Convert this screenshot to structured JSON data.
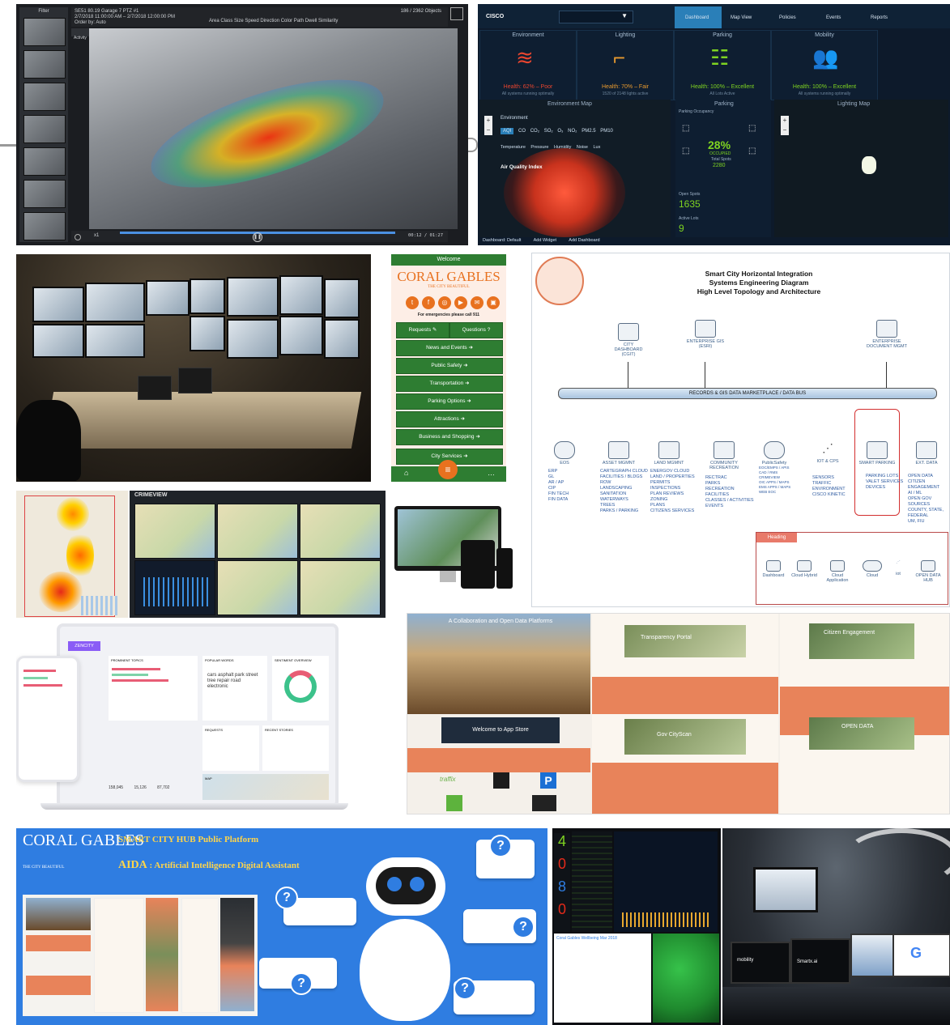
{
  "video": {
    "title": "SE51 80.19 Garage 7 PTZ #1",
    "date_range": "2/7/2018 11:00:00 AM – 2/7/2018 12:00:00 PM",
    "filter": "Order by: Auto",
    "objects": "186 / 2362 Objects",
    "activity_label": "Activity",
    "filters": "Area  Class  Size  Speed  Direction  Color  Path  Dwell  Similarity",
    "speed": "x1",
    "time": "00:12 / 01:27",
    "thumbs_label": "Filter"
  },
  "dash": {
    "brand": "CISCO",
    "tabs": [
      "Dashboard",
      "Map View",
      "Policies",
      "Events",
      "Reports"
    ],
    "cards": [
      {
        "title": "Environment",
        "health": "Health: 62% – Poor",
        "sub": "All systems running optimally",
        "color": "#e8452f"
      },
      {
        "title": "Lighting",
        "health": "Health: 70% – Fair",
        "sub": "1520 of 2148 lights active",
        "color": "#e89a2f"
      },
      {
        "title": "Parking",
        "health": "Health: 100% – Excellent",
        "sub": "All Lots Active",
        "color": "#7ed321"
      },
      {
        "title": "Mobility",
        "health": "Health: 100% – Excellent",
        "sub": "All systems running optimally",
        "color": "#7ed321"
      }
    ],
    "env_map_title": "Environment Map",
    "parking_title": "Parking",
    "lighting_map_title": "Lighting Map",
    "env_select": "Environment",
    "pollutants": [
      "AQI",
      "CO",
      "CO₂",
      "SO₂",
      "O₃",
      "NO₂",
      "PM2.5",
      "PM10"
    ],
    "weather": [
      "Temperature",
      "Pressure",
      "Humidity",
      "Noise",
      "Lux"
    ],
    "aqi_label": "Air Quality Index",
    "occupancy_label": "Parking Occupancy",
    "occupied_pct": "28%",
    "occupied_label": "OCCUPIED",
    "total_spots_label": "Total Spots",
    "total_spots": "2280",
    "open_spots_label": "Open Spots",
    "open_spots": "1635",
    "active_lots_label": "Active Lots",
    "active_lots": "9",
    "footer": [
      "Dashboard: Default",
      "Add Widget",
      "Add Dashboard"
    ]
  },
  "app": {
    "welcome": "Welcome",
    "logo": "CORAL GABLES",
    "tagline": "THE CITY BEAUTIFUL",
    "emergency": "For emergencies please call 911",
    "requests": "Requests",
    "questions": "Questions",
    "menu": [
      "News and Events",
      "Public Safety",
      "Transportation",
      "Parking Options",
      "Attractions",
      "Business and Shopping",
      "City Services"
    ]
  },
  "diagram": {
    "title1": "Smart City Horizontal Integration",
    "title2": "Systems Engineering Diagram",
    "title3": "High Level Topology and Architecture",
    "bus": "RECORDS & GIS DATA MARKETPLACE / DATA BUS",
    "top_nodes": [
      "CITY DASHBOARD (CGIT)",
      "ENTERPRISE GIS (ESRI)",
      "ENTERPRISE DOCUMENT MGMT"
    ],
    "nodes": [
      {
        "label": "EOS",
        "items": [
          "ERP",
          "GL",
          "AR / AP",
          "CIP",
          "FIN TECH",
          "FIN DATA"
        ]
      },
      {
        "label": "ASSET MGMNT",
        "items": [
          "CARTEGRAPH CLOUD",
          "FACILITIES / BLDGS",
          "ROW",
          "LANDSCAPING",
          "SANITATION",
          "WATERWAYS",
          "TREES",
          "PARKS / PARKING"
        ]
      },
      {
        "label": "LAND MGMNT",
        "items": [
          "ENERGOV CLOUD",
          "LAND / PROPERTIES",
          "PERMITS",
          "INSPECTIONS",
          "PLAN REVIEWS",
          "ZONING",
          "PLANS",
          "CITIZENS SERVICES"
        ]
      },
      {
        "label": "COMMUNITY RECREATION",
        "items": [
          "RECTRAC",
          "PARKS",
          "RECREATION",
          "FACILITIES",
          "CLASSES / ACTIVITIES",
          "EVENTS"
        ]
      },
      {
        "label": "PublicSafety",
        "items": [
          "EOC/EMPS / APIS",
          "CAD / RMS",
          "CRIMEVIEW",
          "OIC APPS / MAPS",
          "EMS APPS / MAPS",
          "WEB EOC"
        ]
      },
      {
        "label": "IOT & CPS",
        "items": [
          "SENSORS",
          "TRAFFIC",
          "ENVIRONMENT",
          "CISCO KINETIC"
        ]
      },
      {
        "label": "SMART PARKING",
        "items": [
          "PARKING LOTS",
          "VALET SERVICES",
          "DEVICES"
        ]
      },
      {
        "label": "EXT. DATA",
        "items": [
          "OPEN DATA",
          "CITIZEN ENGAGEMENT",
          "AI / ML",
          "OPEN GOV SOURCES",
          "COUNTY, STATE, FEDERAL",
          "UM, FIU"
        ]
      }
    ],
    "legend_heading": "Heading",
    "legend": [
      "Dashboard",
      "Cloud Hybrid",
      "Cloud Application",
      "Cloud",
      "iot",
      "OPEN DATA HUB"
    ]
  },
  "crime": {
    "logo": "CRIMEVIEW"
  },
  "laptop": {
    "brand": "ZENCITY",
    "cards": [
      "PROMINENT TOPICS",
      "POPULAR WORDS",
      "SENTIMENT OVERVIEW",
      "REQUESTS",
      "RECENT STORIES",
      "MAP"
    ],
    "stats": [
      "158,045",
      "15,126",
      "87,702"
    ],
    "words": [
      "cars",
      "asphalt",
      "park",
      "street",
      "tree",
      "repair",
      "road",
      "electronic"
    ]
  },
  "store": {
    "title": "A Collaboration and Open Data Platforms",
    "welcome": "Welcome to App Store",
    "sections": [
      "Transparency Portal",
      "Citizen Engagement",
      "Gov CityScan",
      "OPEN DATA"
    ],
    "app_name": "traffix"
  },
  "aida": {
    "logo": "CORAL GABLES",
    "logo_sub": "THE CITY BEAUTIFUL",
    "title": "SMART CITY HUB Public Platform",
    "subtitle_strong": "AIDA",
    "subtitle": ": Artificial Intelligence Digital Assistant",
    "question_mark": "?"
  },
  "ops": {
    "digits": [
      "4",
      "0",
      "8",
      "0"
    ],
    "list_title": "Coral Gables Wellbeing Mar 2018"
  },
  "room": {
    "logos": [
      "mobility",
      "Smartx.ai"
    ]
  }
}
